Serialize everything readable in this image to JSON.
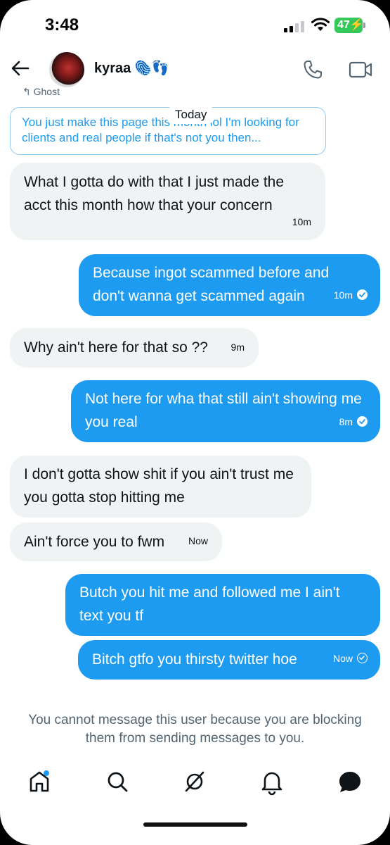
{
  "status": {
    "time": "3:48",
    "battery": "47"
  },
  "header": {
    "name": "kyraa",
    "badges": "🫆👣"
  },
  "preview": {
    "context": "Ghost",
    "text": "You just make this page this month lol I'm looking for clients and real people if that's not you then...",
    "today_label": "Today"
  },
  "messages": [
    {
      "dir": "in",
      "text": "What I gotta do with that I just made the acct this month how that your concern",
      "time": "10m"
    },
    {
      "dir": "out",
      "text": "Because ingot scammed before and don't wanna get scammed again",
      "time": "10m"
    },
    {
      "dir": "in",
      "text": "Why ain't here for that so ??",
      "time": "9m"
    },
    {
      "dir": "out",
      "text": "Not here for wha that still ain't showing me you real",
      "time": "8m"
    },
    {
      "dir": "in",
      "text": "I don't gotta show shit if you ain't trust me you gotta stop hitting me",
      "time": ""
    },
    {
      "dir": "in",
      "text": "Ain't force you to fwm",
      "time": "Now"
    },
    {
      "dir": "out",
      "text": "Butch you hit me and followed me I ain't text you tf",
      "time": ""
    },
    {
      "dir": "out",
      "text": "Bitch gtfo you thirsty twitter hoe",
      "time": "Now"
    }
  ],
  "footer": {
    "blocked_notice": "You cannot message this user because you are blocking them from sending messages to you."
  },
  "tabs": [
    "home-icon",
    "search-icon",
    "grok-icon",
    "notifications-icon",
    "messages-icon"
  ],
  "colors": {
    "accent": "#1d9bf0",
    "incoming_bubble": "#eff3f4"
  }
}
